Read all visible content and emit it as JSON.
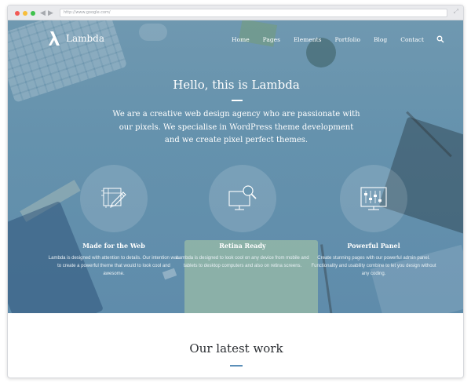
{
  "browser": {
    "url": "http://www.google.com/"
  },
  "header": {
    "logo_text": "Lambda",
    "nav": [
      "Home",
      "Pages",
      "Elements",
      "Portfolio",
      "Blog",
      "Contact"
    ]
  },
  "hero": {
    "title": "Hello, this is Lambda",
    "description": "We are a creative web design agency who are passionate with our pixels. We specialise in WordPress theme development and we create pixel perfect themes."
  },
  "features": [
    {
      "icon": "design-pencil-icon",
      "title": "Made for the Web",
      "text": "Lambda is designed with attention to details. Our intention was to create a powerful theme that would to look cool and awesome."
    },
    {
      "icon": "monitor-magnifier-icon",
      "title": "Retina Ready",
      "text": "Lambda is designed to look cool on any device from mobile and tablets to desktop computers and also on retina screens."
    },
    {
      "icon": "control-panel-icon",
      "title": "Powerful Panel",
      "text": "Create stunning pages with our powerful admin panel. Functionality and usability combine to let you design without any coding."
    }
  ],
  "latest": {
    "title": "Our latest work"
  },
  "colors": {
    "hero_overlay": "#6592ad",
    "accent": "#5b8fb8",
    "text_dark": "#2c2f33"
  }
}
